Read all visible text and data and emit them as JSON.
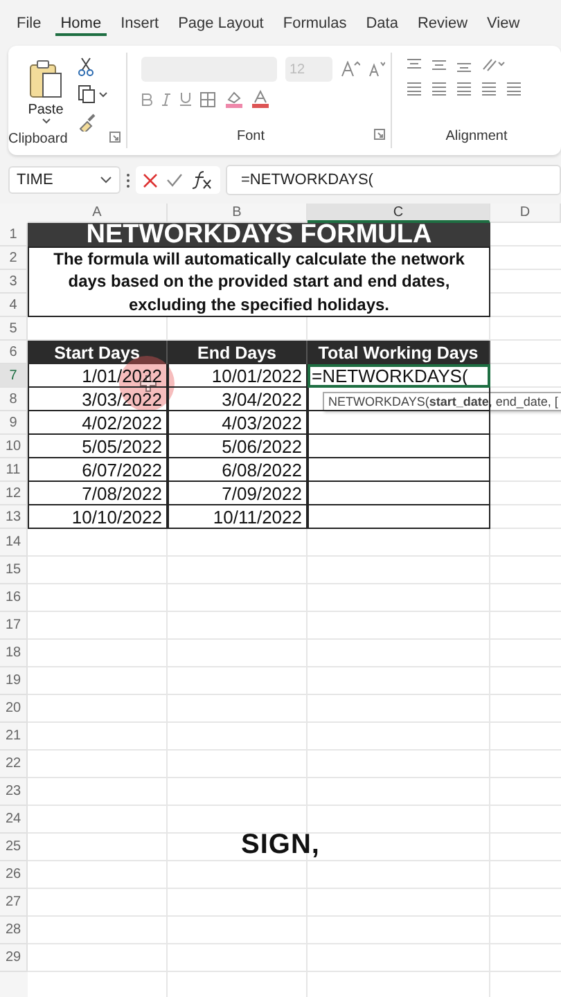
{
  "ribbon": {
    "tabs": [
      {
        "label": "File",
        "selected": false
      },
      {
        "label": "Home",
        "selected": true
      },
      {
        "label": "Insert",
        "selected": false
      },
      {
        "label": "Page Layout",
        "selected": false
      },
      {
        "label": "Formulas",
        "selected": false
      },
      {
        "label": "Data",
        "selected": false
      },
      {
        "label": "Review",
        "selected": false
      },
      {
        "label": "View",
        "selected": false
      }
    ],
    "paste_label": "Paste",
    "font_size": "12",
    "groups": [
      "Clipboard",
      "Font",
      "Alignment"
    ]
  },
  "formula_bar": {
    "name_box": "TIME",
    "formula": "=NETWORKDAYS("
  },
  "sheet": {
    "columns": [
      {
        "label": "A",
        "selected": false
      },
      {
        "label": "B",
        "selected": false
      },
      {
        "label": "C",
        "selected": true
      },
      {
        "label": "D",
        "selected": false
      }
    ],
    "title": "NETWORKDAYS FORMULA",
    "description": "The formula will automatically calculate the network days based on the provided start and end dates, excluding the specified holidays.",
    "headers": [
      "Start Days",
      "End Days",
      "Total Working Days"
    ],
    "rows": [
      {
        "start": "1/01/2022",
        "end": "10/01/2022",
        "total": "=NETWORKDAYS(",
        "active": true
      },
      {
        "start": "3/03/2022",
        "end": "3/04/2022",
        "total": "",
        "active": false
      },
      {
        "start": "4/02/2022",
        "end": "4/03/2022",
        "total": "",
        "active": false
      },
      {
        "start": "5/05/2022",
        "end": "5/06/2022",
        "total": "",
        "active": false
      },
      {
        "start": "6/07/2022",
        "end": "6/08/2022",
        "total": "",
        "active": false
      },
      {
        "start": "7/08/2022",
        "end": "7/09/2022",
        "total": "",
        "active": false
      },
      {
        "start": "10/10/2022",
        "end": "10/11/2022",
        "total": "",
        "active": false
      }
    ],
    "row_numbers": [
      {
        "label": "1",
        "selected": false
      },
      {
        "label": "2",
        "selected": false
      },
      {
        "label": "3",
        "selected": false
      },
      {
        "label": "4",
        "selected": false
      },
      {
        "label": "5",
        "selected": false
      },
      {
        "label": "6",
        "selected": false
      },
      {
        "label": "7",
        "selected": true
      },
      {
        "label": "8",
        "selected": false
      },
      {
        "label": "9",
        "selected": false
      },
      {
        "label": "10",
        "selected": false
      },
      {
        "label": "11",
        "selected": false
      },
      {
        "label": "12",
        "selected": false
      },
      {
        "label": "13",
        "selected": false
      },
      {
        "label": "14",
        "selected": false
      },
      {
        "label": "15",
        "selected": false
      },
      {
        "label": "16",
        "selected": false
      },
      {
        "label": "17",
        "selected": false
      },
      {
        "label": "18",
        "selected": false
      },
      {
        "label": "19",
        "selected": false
      },
      {
        "label": "20",
        "selected": false
      },
      {
        "label": "21",
        "selected": false
      },
      {
        "label": "22",
        "selected": false
      },
      {
        "label": "23",
        "selected": false
      },
      {
        "label": "24",
        "selected": false
      },
      {
        "label": "25",
        "selected": false
      },
      {
        "label": "26",
        "selected": false
      },
      {
        "label": "27",
        "selected": false
      },
      {
        "label": "28",
        "selected": false
      },
      {
        "label": "29",
        "selected": false
      }
    ],
    "tooltip": "NETWORKDAYS(**start_date**, end_date, ["
  },
  "caption": "SIGN,"
}
